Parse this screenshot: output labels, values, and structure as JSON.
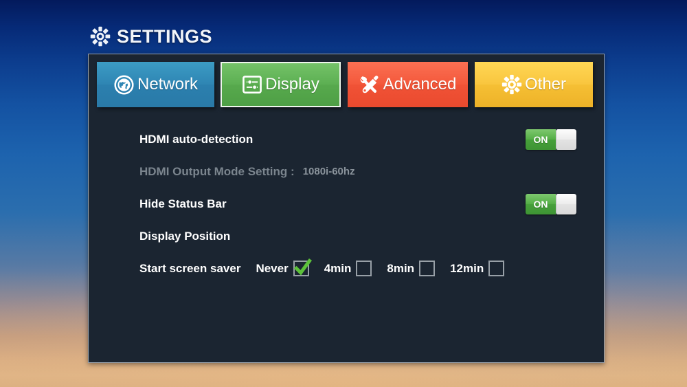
{
  "header": {
    "title": "SETTINGS",
    "icon": "gear-icon"
  },
  "tabs": [
    {
      "id": "network",
      "label": "Network",
      "icon": "globe-icon",
      "color": "#2f86b4",
      "selected": false
    },
    {
      "id": "display",
      "label": "Display",
      "icon": "sliders-icon",
      "color": "#5db053",
      "selected": true
    },
    {
      "id": "advanced",
      "label": "Advanced",
      "icon": "tools-icon",
      "color": "#f4593c",
      "selected": false
    },
    {
      "id": "other",
      "label": "Other",
      "icon": "gear-icon",
      "color": "#f9c63f",
      "selected": false
    }
  ],
  "settings": {
    "hdmi_auto_detection": {
      "label": "HDMI auto-detection",
      "toggle_state": "ON"
    },
    "hdmi_output_mode": {
      "label": "HDMI Output Mode Setting :",
      "value": "1080i-60hz"
    },
    "hide_status_bar": {
      "label": "Hide Status Bar",
      "toggle_state": "ON"
    },
    "display_position": {
      "label": "Display Position"
    },
    "screen_saver": {
      "label": "Start screen saver",
      "options": [
        {
          "label": "Never",
          "checked": true
        },
        {
          "label": "4min",
          "checked": false
        },
        {
          "label": "8min",
          "checked": false
        },
        {
          "label": "12min",
          "checked": false
        }
      ]
    }
  },
  "colors": {
    "panel_background": "#1b2531",
    "panel_border": "#9aa3ad",
    "toggle_on": "#4aa73e",
    "check_green": "#5cc13a",
    "dim_text": "#7b858e"
  }
}
